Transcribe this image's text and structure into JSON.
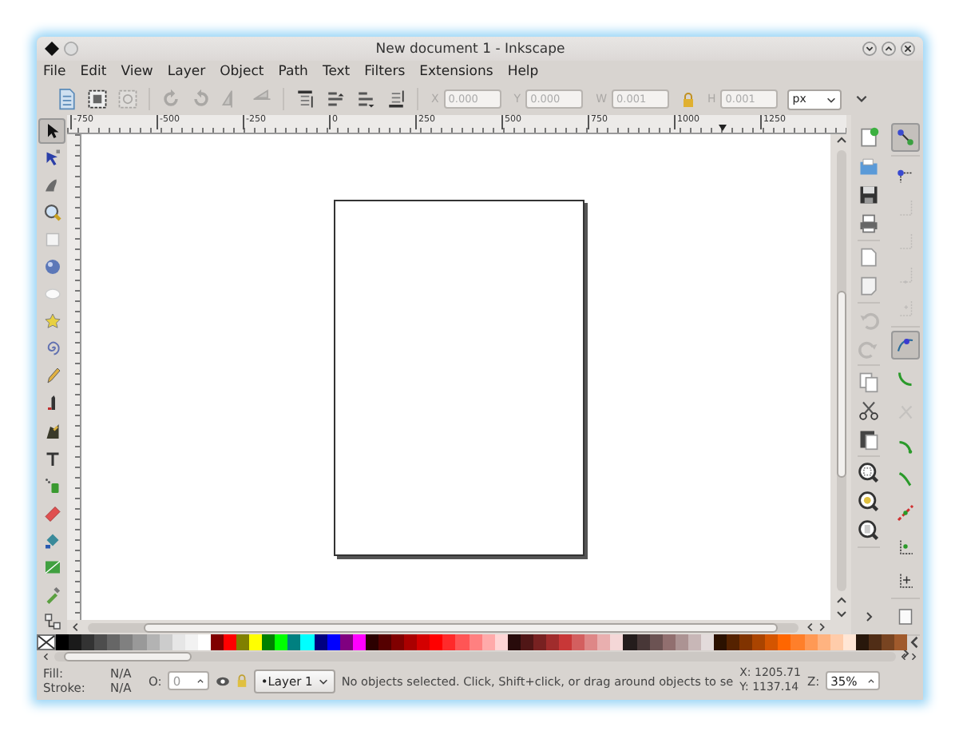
{
  "window": {
    "title": "New document 1 - Inkscape"
  },
  "menu": [
    {
      "label": "File"
    },
    {
      "label": "Edit"
    },
    {
      "label": "View"
    },
    {
      "label": "Layer"
    },
    {
      "label": "Object"
    },
    {
      "label": "Path"
    },
    {
      "label": "Text"
    },
    {
      "label": "Filters"
    },
    {
      "label": "Extensions"
    },
    {
      "label": "Help"
    }
  ],
  "toolbar": {
    "groups": [
      [
        {
          "kind": "select-all",
          "disabled": false
        },
        {
          "kind": "select-all-layers",
          "disabled": false
        },
        {
          "kind": "deselect",
          "disabled": true
        }
      ],
      [
        {
          "kind": "rotate-ccw",
          "disabled": true
        },
        {
          "kind": "rotate-cw",
          "disabled": true
        },
        {
          "kind": "flip-h",
          "disabled": true
        },
        {
          "kind": "flip-v",
          "disabled": true
        }
      ],
      [
        {
          "kind": "raise-top",
          "disabled": false
        },
        {
          "kind": "raise",
          "disabled": false
        },
        {
          "kind": "lower",
          "disabled": false
        },
        {
          "kind": "lower-bottom",
          "disabled": false
        }
      ]
    ],
    "fields": [
      {
        "label": "X",
        "value": "0.000",
        "disabled": true
      },
      {
        "label": "Y",
        "value": "0.000",
        "disabled": true
      },
      {
        "label": "W",
        "value": "0.001",
        "disabled": true
      },
      {
        "label": "H",
        "value": "0.001",
        "disabled": true
      }
    ],
    "unit": "px"
  },
  "ruler": {
    "labels": [
      "-750",
      "-500",
      "-250",
      "0",
      "250",
      "500",
      "750",
      "1000",
      "1250"
    ]
  },
  "tools": [
    {
      "kind": "selector",
      "selected": true
    },
    {
      "kind": "node",
      "selected": false
    },
    {
      "kind": "tweak",
      "selected": false
    },
    {
      "kind": "zoom",
      "selected": false
    },
    {
      "kind": "rect",
      "selected": false
    },
    {
      "kind": "box3d",
      "selected": false
    },
    {
      "kind": "ellipse",
      "selected": false
    },
    {
      "kind": "star",
      "selected": false
    },
    {
      "kind": "spiral",
      "selected": false
    },
    {
      "kind": "pencil",
      "selected": false
    },
    {
      "kind": "pen",
      "selected": false
    },
    {
      "kind": "calligraphy",
      "selected": false
    },
    {
      "kind": "text",
      "selected": false
    },
    {
      "kind": "spray",
      "selected": false
    },
    {
      "kind": "eraser",
      "selected": false
    },
    {
      "kind": "bucket",
      "selected": false
    },
    {
      "kind": "gradient",
      "selected": false
    },
    {
      "kind": "dropper",
      "selected": false
    },
    {
      "kind": "connector",
      "selected": false
    }
  ],
  "commands": [
    [
      {
        "kind": "new",
        "disabled": false
      },
      {
        "kind": "open",
        "disabled": false
      },
      {
        "kind": "save",
        "disabled": false
      },
      {
        "kind": "print",
        "disabled": false
      }
    ],
    [
      {
        "kind": "import",
        "disabled": false
      },
      {
        "kind": "export",
        "disabled": false
      }
    ],
    [
      {
        "kind": "undo",
        "disabled": true
      },
      {
        "kind": "redo",
        "disabled": true
      }
    ],
    [
      {
        "kind": "copy",
        "disabled": false
      },
      {
        "kind": "cut",
        "disabled": false
      },
      {
        "kind": "paste",
        "disabled": false
      }
    ],
    [
      {
        "kind": "zoom-selection",
        "disabled": false
      },
      {
        "kind": "zoom-drawing",
        "disabled": false
      },
      {
        "kind": "zoom-page",
        "disabled": false
      }
    ]
  ],
  "snaps": [
    [
      {
        "kind": "snap",
        "selected": true,
        "disabled": false
      }
    ],
    [
      {
        "kind": "bbox",
        "selected": false,
        "disabled": false
      },
      {
        "kind": "bbox-edge",
        "selected": false,
        "disabled": true
      },
      {
        "kind": "bbox-corner",
        "selected": false,
        "disabled": true
      },
      {
        "kind": "bbox-midpoint",
        "selected": false,
        "disabled": true
      },
      {
        "kind": "bbox-center",
        "selected": false,
        "disabled": true
      }
    ],
    [
      {
        "kind": "nodes",
        "selected": true,
        "disabled": false
      },
      {
        "kind": "paths",
        "selected": false,
        "disabled": false
      },
      {
        "kind": "intersections",
        "selected": false,
        "disabled": true
      },
      {
        "kind": "cusp",
        "selected": false,
        "disabled": false
      },
      {
        "kind": "smooth",
        "selected": false,
        "disabled": false
      },
      {
        "kind": "line-midpoint",
        "selected": false,
        "disabled": false
      },
      {
        "kind": "object-midpoint",
        "selected": false,
        "disabled": false
      },
      {
        "kind": "rotation-center",
        "selected": false,
        "disabled": false
      }
    ],
    [
      {
        "kind": "page",
        "selected": false,
        "disabled": false
      }
    ]
  ],
  "palette": [
    {
      "color": "#000000"
    },
    {
      "color": "#1a1a1a"
    },
    {
      "color": "#333333"
    },
    {
      "color": "#4d4d4d"
    },
    {
      "color": "#666666"
    },
    {
      "color": "#808080"
    },
    {
      "color": "#999999"
    },
    {
      "color": "#b3b3b3"
    },
    {
      "color": "#cccccc"
    },
    {
      "color": "#e6e6e6"
    },
    {
      "color": "#f2f2f2"
    },
    {
      "color": "#ffffff"
    },
    {
      "color": "#800000"
    },
    {
      "color": "#ff0000"
    },
    {
      "color": "#808000"
    },
    {
      "color": "#ffff00"
    },
    {
      "color": "#008000"
    },
    {
      "color": "#00ff00"
    },
    {
      "color": "#008080"
    },
    {
      "color": "#00ffff"
    },
    {
      "color": "#000080"
    },
    {
      "color": "#0000ff"
    },
    {
      "color": "#800080"
    },
    {
      "color": "#ff00ff"
    },
    {
      "color": "#2b0000"
    },
    {
      "color": "#550000"
    },
    {
      "color": "#800000"
    },
    {
      "color": "#aa0000"
    },
    {
      "color": "#d40000"
    },
    {
      "color": "#ff0000"
    },
    {
      "color": "#ff2a2a"
    },
    {
      "color": "#ff5555"
    },
    {
      "color": "#ff8080"
    },
    {
      "color": "#ffaaaa"
    },
    {
      "color": "#ffd5d5"
    },
    {
      "color": "#280b0b"
    },
    {
      "color": "#501616"
    },
    {
      "color": "#782121"
    },
    {
      "color": "#a02c2c"
    },
    {
      "color": "#c83737"
    },
    {
      "color": "#d35f5f"
    },
    {
      "color": "#de8787"
    },
    {
      "color": "#e9afaf"
    },
    {
      "color": "#f4d7d7"
    },
    {
      "color": "#241c1c"
    },
    {
      "color": "#483737"
    },
    {
      "color": "#6c5353"
    },
    {
      "color": "#916f6f"
    },
    {
      "color": "#ac9393"
    },
    {
      "color": "#c8b7b7"
    },
    {
      "color": "#e3dbdb"
    },
    {
      "color": "#2b1100"
    },
    {
      "color": "#552200"
    },
    {
      "color": "#803300"
    },
    {
      "color": "#aa4400"
    },
    {
      "color": "#d45500"
    },
    {
      "color": "#ff6600"
    },
    {
      "color": "#ff7f2a"
    },
    {
      "color": "#ff9955"
    },
    {
      "color": "#ffb380"
    },
    {
      "color": "#ffccaa"
    },
    {
      "color": "#ffe6d5"
    },
    {
      "color": "#28170b"
    },
    {
      "color": "#502d16"
    },
    {
      "color": "#784421"
    },
    {
      "color": "#a05a2c"
    }
  ],
  "status": {
    "fill_label": "Fill:",
    "fill": "N/A",
    "stroke_label": "Stroke:",
    "stroke": "N/A",
    "opacity_label": "O:",
    "opacity": "0",
    "layer": "•Layer 1",
    "message": "No objects selected. Click, Shift+click, or drag around objects to se",
    "x": "X: 1205.71",
    "y": "Y: 1137.14",
    "zoom_label": "Z:",
    "zoom": "35%"
  }
}
